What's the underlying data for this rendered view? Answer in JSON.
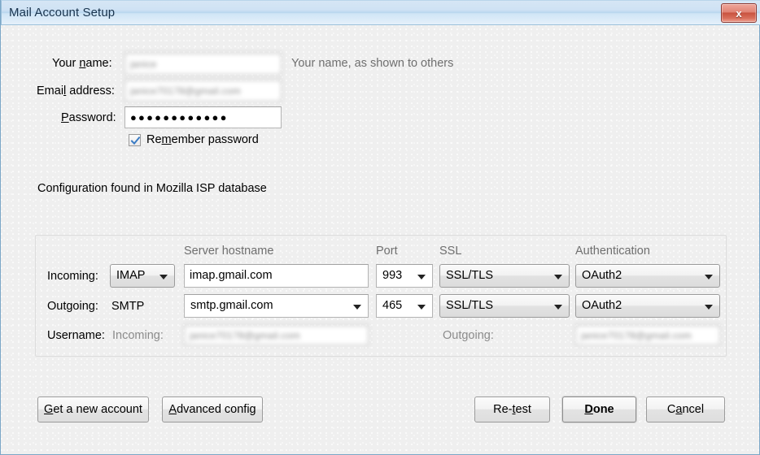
{
  "window": {
    "title": "Mail Account Setup",
    "close_icon": "close-icon",
    "close_label": "x"
  },
  "form": {
    "name": {
      "label_pre": "Your ",
      "label_accel": "n",
      "label_post": "ame:",
      "value": "janice",
      "hint": "Your name, as shown to others"
    },
    "email": {
      "label_pre": "Emai",
      "label_accel": "l",
      "label_post": " address:",
      "value": "janice70178@gmail.com"
    },
    "password": {
      "label_pre": "",
      "label_accel": "P",
      "label_post": "assword:",
      "value": "●●●●●●●●●●●●"
    },
    "remember": {
      "label_pre": "Re",
      "label_accel": "m",
      "label_post": "ember password",
      "checked": true,
      "check_color": "#3b7cc4"
    }
  },
  "status": {
    "message": "Configuration found in Mozilla ISP database"
  },
  "settings": {
    "headers": {
      "hostname": "Server hostname",
      "port": "Port",
      "ssl": "SSL",
      "auth": "Authentication"
    },
    "incoming": {
      "row_label": "Incoming:",
      "protocol": "IMAP",
      "hostname": "imap.gmail.com",
      "port": "993",
      "ssl": "SSL/TLS",
      "auth": "OAuth2"
    },
    "outgoing": {
      "row_label": "Outgoing:",
      "protocol": "SMTP",
      "hostname": "smtp.gmail.com",
      "port": "465",
      "ssl": "SSL/TLS",
      "auth": "OAuth2"
    },
    "username": {
      "row_label": "Username:",
      "incoming_label": "Incoming:",
      "incoming_value": "janice70178@gmail.com",
      "outgoing_label": "Outgoing:",
      "outgoing_value": "janice70178@gmail.com"
    }
  },
  "buttons": {
    "get_new_account": {
      "pre": "",
      "accel": "G",
      "post": "et a new account"
    },
    "advanced_config": {
      "pre": "",
      "accel": "A",
      "post": "dvanced config"
    },
    "retest": {
      "pre": "Re-",
      "accel": "t",
      "post": "est"
    },
    "done": {
      "pre": "",
      "accel": "D",
      "post": "one"
    },
    "cancel": {
      "pre": "C",
      "accel": "a",
      "post": "ncel"
    }
  }
}
